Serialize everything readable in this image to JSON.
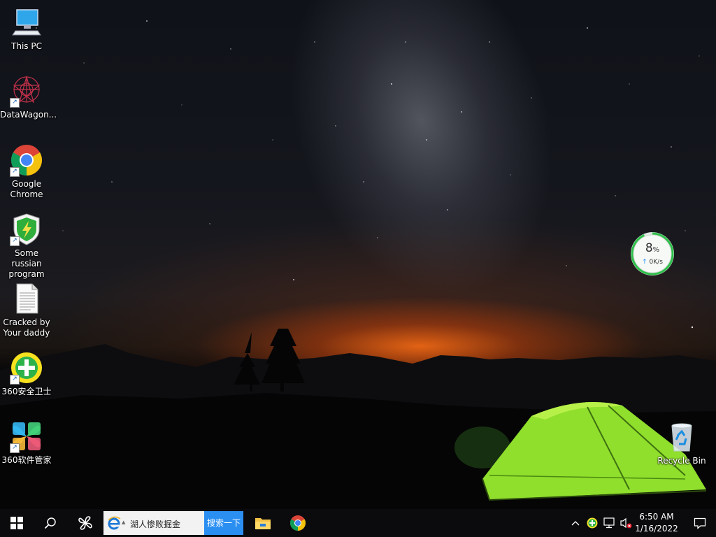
{
  "desktop": {
    "icons": [
      {
        "label": "This PC",
        "icon": "this-pc-icon",
        "shortcut": false
      },
      {
        "label": "DataWagon...",
        "icon": "datawagon-icon",
        "shortcut": true
      },
      {
        "label": "Google Chrome",
        "icon": "chrome-icon",
        "shortcut": true
      },
      {
        "label": "Some russian program",
        "icon": "shield-icon",
        "shortcut": true
      },
      {
        "label": "Cracked by Your daddy",
        "icon": "text-file-icon",
        "shortcut": false
      },
      {
        "label": "360安全卫士",
        "icon": "360-security-icon",
        "shortcut": true
      },
      {
        "label": "360软件管家",
        "icon": "360-software-icon",
        "shortcut": true
      },
      {
        "label": "Recycle Bin",
        "icon": "recycle-bin-icon",
        "shortcut": false
      }
    ]
  },
  "widget": {
    "percent": "8",
    "percent_sign": "%",
    "speed_arrow": "↑",
    "speed": "0K/s",
    "ring_color": "#2fbf4a"
  },
  "taskbar": {
    "background": "#0b0b0d",
    "start_icon": "windows-logo-icon",
    "search_icon": "search-icon",
    "pinwheel_icon": "pinwheel-icon",
    "ie_search": {
      "text": "湖人惨败掘金",
      "caret": "▲",
      "button": "搜索一下",
      "button_color": "#2b8ff2"
    },
    "apps": [
      "file-explorer-icon",
      "chrome-icon"
    ],
    "tray": {
      "chevron": "^",
      "icons": [
        "360-tray-icon",
        "network-icon",
        "volume-muted-icon"
      ]
    },
    "clock": {
      "time": "6:50 AM",
      "date": "1/16/2022"
    },
    "notification_icon": "notification-icon"
  }
}
